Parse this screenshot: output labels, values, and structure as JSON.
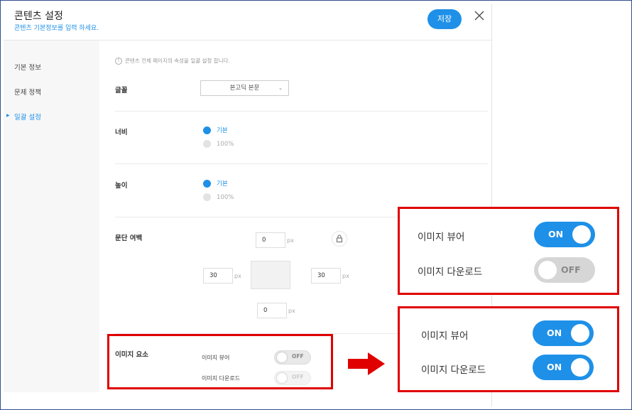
{
  "dialog": {
    "title": "콘텐츠 설정",
    "subtitle": "콘텐츠 기본정보를 입력 하세요.",
    "save_label": "저장"
  },
  "sidebar": {
    "items": [
      {
        "label": "기본 정보",
        "active": false
      },
      {
        "label": "문제 정책",
        "active": false
      },
      {
        "label": "일괄 설정",
        "active": true
      }
    ]
  },
  "main": {
    "notice": "콘텐츠 전체 페이지의 속성을 일괄 설정 합니다.",
    "font": {
      "label": "글꼴",
      "selected": "본고딕 본문"
    },
    "width": {
      "label": "너비",
      "options": [
        {
          "label": "기본",
          "selected": true
        },
        {
          "label": "100%",
          "selected": false
        }
      ]
    },
    "height": {
      "label": "높이",
      "options": [
        {
          "label": "기본",
          "selected": true
        },
        {
          "label": "100%",
          "selected": false
        }
      ]
    },
    "paragraph_margin": {
      "label": "문단 여백",
      "unit": "px",
      "top": "0",
      "left": "30",
      "right": "30",
      "bottom": "0"
    },
    "image_elements": {
      "label": "이미지 요소",
      "viewer": {
        "label": "이미지 뷰어",
        "state": "OFF"
      },
      "download": {
        "label": "이미지 다운로드",
        "state": "OFF",
        "disabled": true
      }
    }
  },
  "callout_top": {
    "viewer": {
      "label": "이미지 뷰어",
      "state": "ON"
    },
    "download": {
      "label": "이미지 다운로드",
      "state": "OFF"
    }
  },
  "callout_bottom": {
    "viewer": {
      "label": "이미지 뷰어",
      "state": "ON"
    },
    "download": {
      "label": "이미지 다운로드",
      "state": "ON"
    }
  },
  "colors": {
    "accent": "#1e90e8",
    "highlight": "#e00000"
  }
}
